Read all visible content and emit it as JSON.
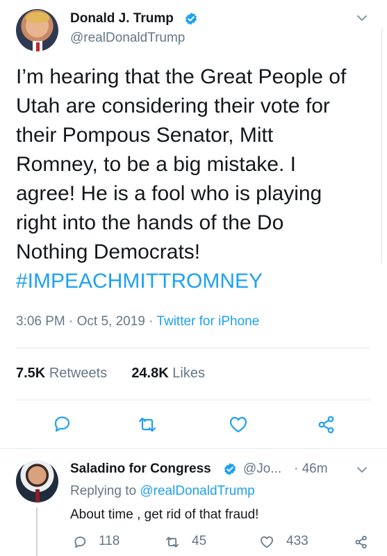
{
  "tweet": {
    "display_name": "Donald J. Trump",
    "handle": "@realDonaldTrump",
    "text": "I’m hearing that the Great People of\nUtah are considering their vote for\ntheir Pompous Senator, Mitt\nRomney, to be a big mistake. I\nagree! He is a fool who is playing\nright into the hands of the Do\nNothing Democrats!",
    "hashtag": "#IMPEACHMITTROMNEY",
    "time": "3:06 PM · Oct 5, 2019 · ",
    "source": "Twitter for iPhone",
    "retweets_count": "7.5K",
    "retweets_label": "Retweets",
    "likes_count": "24.8K",
    "likes_label": "Likes"
  },
  "reply": {
    "display_name": "Saladino for Congress",
    "handle": "@Jo...",
    "time": "· 46m",
    "replying_prefix": "Replying to ",
    "replying_to": "@realDonaldTrump",
    "text": "About time , get rid of that fraud!",
    "reply_count": "118",
    "retweet_count": "45",
    "like_count": "433"
  },
  "colors": {
    "accent": "#1da1f2",
    "secondary_text": "#657786",
    "primary_text": "#14171a",
    "divider": "#e1e8ed"
  },
  "icons": [
    "verified-badge-icon",
    "chevron-down-icon",
    "reply-icon",
    "retweet-icon",
    "like-icon",
    "share-icon"
  ]
}
